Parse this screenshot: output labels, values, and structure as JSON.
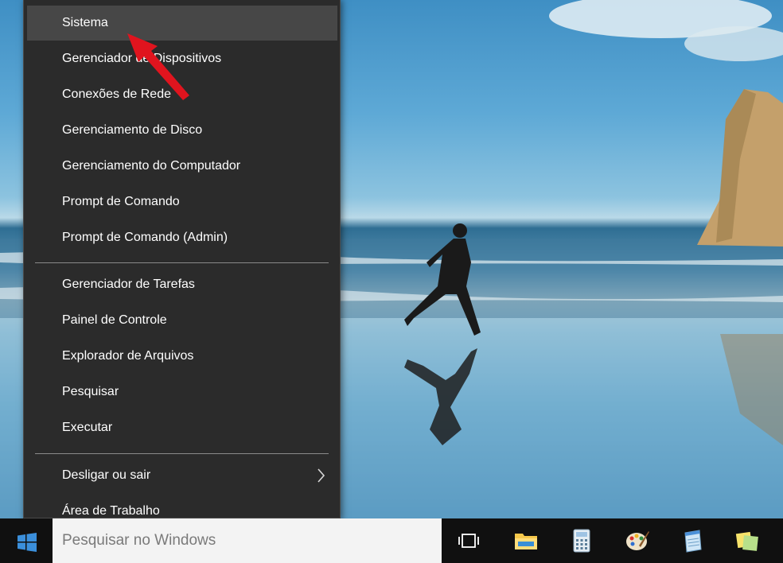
{
  "menu": {
    "groups": [
      {
        "items": [
          {
            "label": "Sistema",
            "highlighted": true
          },
          {
            "label": "Gerenciador de Dispositivos"
          },
          {
            "label": "Conexões de Rede"
          },
          {
            "label": "Gerenciamento de Disco"
          },
          {
            "label": "Gerenciamento do Computador"
          },
          {
            "label": "Prompt de Comando"
          },
          {
            "label": "Prompt de Comando (Admin)"
          }
        ]
      },
      {
        "items": [
          {
            "label": "Gerenciador de Tarefas"
          },
          {
            "label": "Painel de Controle"
          },
          {
            "label": "Explorador de Arquivos"
          },
          {
            "label": "Pesquisar"
          },
          {
            "label": "Executar"
          }
        ]
      },
      {
        "items": [
          {
            "label": "Desligar ou sair",
            "submenu": true
          },
          {
            "label": "Área de Trabalho"
          }
        ]
      }
    ]
  },
  "taskbar": {
    "search_placeholder": "Pesquisar no Windows",
    "icons": [
      "task-view-icon",
      "file-explorer-icon",
      "calculator-icon",
      "paint-icon",
      "notepad-icon",
      "sticky-notes-icon"
    ]
  },
  "colors": {
    "menu_background": "#2b2b2b",
    "menu_highlight": "#474747",
    "taskbar": "#101010",
    "annotation_arrow": "#e0141e"
  }
}
